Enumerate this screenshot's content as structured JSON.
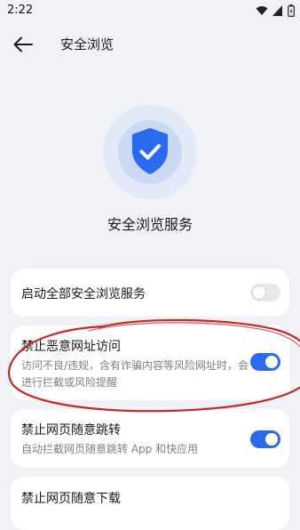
{
  "status_bar": {
    "time": "2:22"
  },
  "header": {
    "title": "安全浏览"
  },
  "hero": {
    "title": "安全浏览服务"
  },
  "settings": [
    {
      "title": "启动全部安全浏览服务",
      "subtitle": "",
      "enabled": false
    },
    {
      "title": "禁止恶意网址访问",
      "subtitle": "访问不良/违规，含有诈骗内容等风险网址时，会进行拦截或风险提醒",
      "enabled": true
    },
    {
      "title": "禁止网页随意跳转",
      "subtitle": "自动拦截网页随意跳转 App 和快应用",
      "enabled": true
    },
    {
      "title": "禁止网页随意下载",
      "subtitle": "",
      "enabled": true
    }
  ],
  "colors": {
    "accent": "#2a6af0",
    "annotation": "#c42b2b",
    "background": "#f1f2f5"
  },
  "icons": {
    "back": "arrow-left-icon",
    "shield": "shield-check-icon",
    "wifi": "wifi-icon",
    "signal": "signal-icon",
    "battery": "battery-icon"
  }
}
